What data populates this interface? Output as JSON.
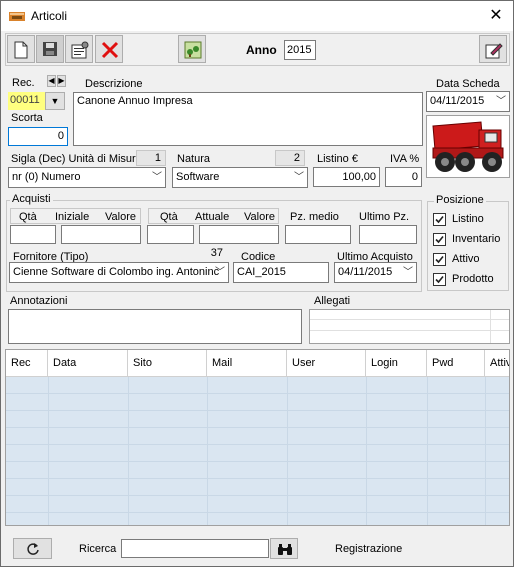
{
  "window": {
    "title": "Articoli",
    "close_glyph": "✕"
  },
  "toolbar": {
    "icons": [
      "new-icon",
      "save-icon",
      "properties-icon",
      "delete-icon",
      "tree-icon",
      "edit-note-icon"
    ],
    "anno_label": "Anno",
    "anno_value": "2015"
  },
  "form": {
    "rec_label": "Rec.",
    "rec_value": "00011",
    "descrizione_label": "Descrizione",
    "descrizione_value": "Canone Annuo Impresa",
    "data_scheda_label": "Data Scheda",
    "data_scheda_value": "04/11/2015",
    "scorta_label": "Scorta",
    "scorta_value": "0",
    "sigla_label": "Sigla (Dec) Unità di Misura",
    "sigla_count": "1",
    "sigla_value": "nr (0) Numero",
    "natura_label": "Natura",
    "natura_count": "2",
    "natura_value": "Software",
    "listino_label": "Listino €",
    "listino_value": "100,00",
    "iva_label": "IVA %",
    "iva_value": "0"
  },
  "acquisti": {
    "group_label": "Acquisti",
    "qta1": "Qtà",
    "iniziale": "Iniziale",
    "valore1": "Valore",
    "qta2": "Qtà",
    "attuale": "Attuale",
    "valore2": "Valore",
    "pz_medio": "Pz. medio",
    "ultimo_pz": "Ultimo Pz.",
    "fornitore_label": "Fornitore  (Tipo)",
    "fornitore_count": "37",
    "fornitore_value": "Cienne Software di Colombo ing. Antoninc",
    "codice_label": "Codice",
    "codice_value": "CAI_2015",
    "ultimo_acquisto_label": "Ultimo Acquisto",
    "ultimo_acquisto_value": "04/11/2015"
  },
  "posizione": {
    "group_label": "Posizione",
    "items": [
      {
        "label": "Listino",
        "checked": true
      },
      {
        "label": "Inventario",
        "checked": true
      },
      {
        "label": "Attivo",
        "checked": true
      },
      {
        "label": "Prodotto",
        "checked": true
      }
    ]
  },
  "annotazioni_label": "Annotazioni",
  "allegati_label": "Allegati",
  "grid": {
    "columns": [
      "Rec",
      "Data",
      "Sito",
      "Mail",
      "User",
      "Login",
      "Pwd",
      "Attiv"
    ]
  },
  "footer": {
    "ricerca_label": "Ricerca",
    "ricerca_value": "",
    "registrazione_label": "Registrazione"
  },
  "colors": {
    "rec_highlight": "#ffff80",
    "grid_row_bg": "#dae6f1",
    "delete_red": "#e01010"
  }
}
